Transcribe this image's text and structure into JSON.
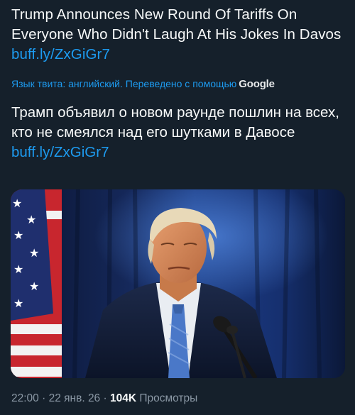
{
  "tweet": {
    "original_text": "Trump Announces New Round Of Tariffs On Everyone Who Didn't Laugh At His Jokes In Davos ",
    "original_link": "buff.ly/ZxGiGr7",
    "translation_notice": "Язык твита: английский. Переведено с помощью",
    "translation_provider": "Google",
    "translated_text": "Трамп объявил о новом раунде пошлин на всех, кто не смеялся над его шутками в Давосе ",
    "translated_link": "buff.ly/ZxGiGr7",
    "time": "22:00",
    "date": "22 янв. 26",
    "separator": "·",
    "views_count": "104K",
    "views_label": "Просмотры"
  },
  "colors": {
    "background": "#15202b",
    "text": "#f7f9f9",
    "link": "#1d9bf0",
    "secondary": "#8b98a5"
  }
}
